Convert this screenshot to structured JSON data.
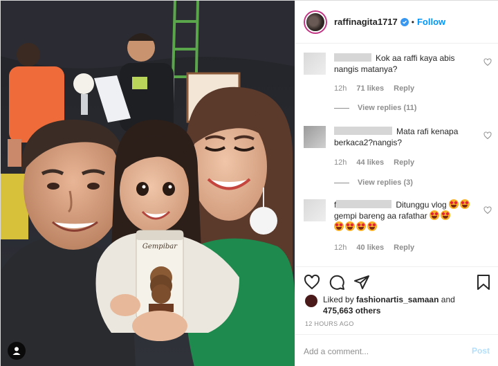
{
  "header": {
    "username": "raffinagita1717",
    "separator": "•",
    "follow_label": "Follow"
  },
  "comments": [
    {
      "text_a": "Kok aa raffi kaya abis",
      "text_b": "nangis matanya?",
      "time": "12h",
      "likes": "71 likes",
      "reply_label": "Reply",
      "view_replies": "View replies (11)"
    },
    {
      "text_a": "Mata rafi kenapa",
      "text_b": "berkaca2?nangis?",
      "time": "12h",
      "likes": "44 likes",
      "reply_label": "Reply",
      "view_replies": "View replies (3)"
    },
    {
      "name_initial": "f",
      "text_a": "Ditunggu vlog",
      "text_b": "gempi bareng aa rafathar",
      "time": "12h",
      "likes": "40 likes",
      "reply_label": "Reply"
    }
  ],
  "liked_by": {
    "prefix": "Liked by",
    "user": "fashionartis_samaan",
    "conj": "and",
    "others": "475,663 others"
  },
  "timestamp": "12 HOURS AGO",
  "add_comment": {
    "placeholder": "Add a comment...",
    "post_label": "Post"
  },
  "photo": {
    "product_label": "Gempibar"
  },
  "colors": {
    "link_blue": "#0095f6",
    "post_disabled": "#b2dffc",
    "verified_blue": "#3897f0",
    "muted": "#8e8e8e"
  },
  "icons": [
    "verified-badge-icon",
    "heart-icon",
    "comment-icon",
    "share-icon",
    "bookmark-icon",
    "user-tag-icon"
  ]
}
